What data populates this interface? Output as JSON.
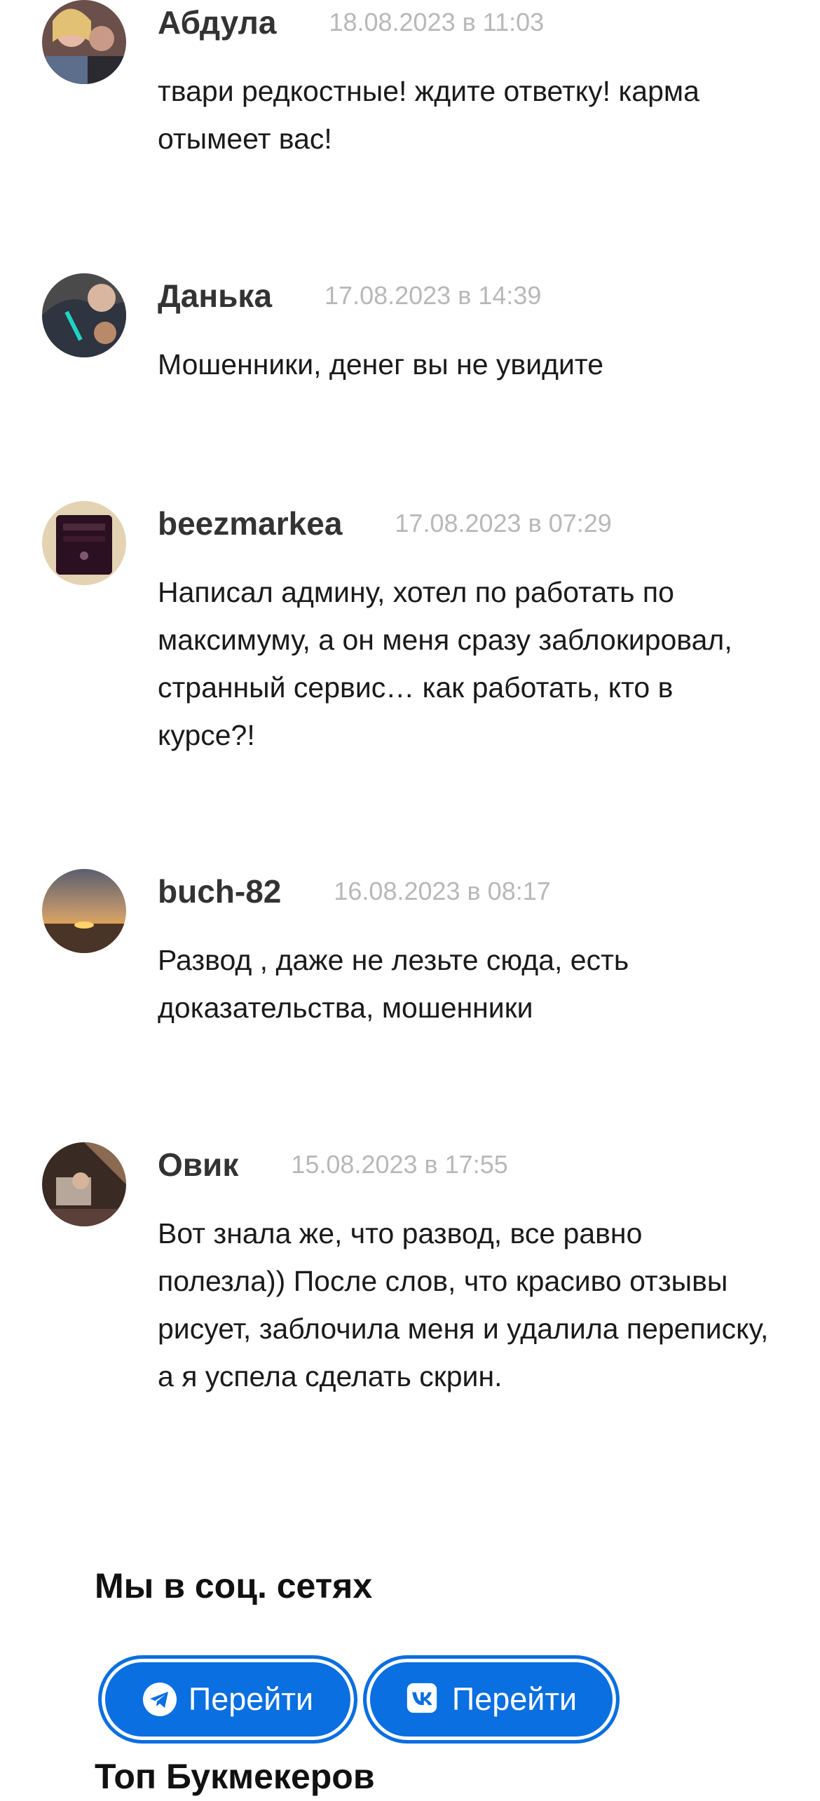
{
  "comments": [
    {
      "author": "Абдула",
      "date": "18.08.2023 в 11:03",
      "text": "твари редкостные! ждите ответку! карма отымеет вас!"
    },
    {
      "author": "Данька",
      "date": "17.08.2023 в 14:39",
      "text": "Мошенники, денег вы не увидите"
    },
    {
      "author": "beezmarkea",
      "date": "17.08.2023 в 07:29",
      "text": "Написал админу, хотел по работать по максимуму, а он меня сразу заблокировал, странный сервис… как работать, кто в курсе?!"
    },
    {
      "author": "buch-82",
      "date": "16.08.2023 в 08:17",
      "text": "Развод , даже не лезьте сюда, есть доказательства, мошенники"
    },
    {
      "author": "Овик",
      "date": "15.08.2023 в 17:55",
      "text": "Вот знала же, что развод, все равно полезла)) После слов, что красиво отзывы рисует, заблочила меня и удалила переписку, а я успела сделать скрин."
    }
  ],
  "social": {
    "title": "Мы в соц. сетях",
    "buttons": [
      {
        "icon": "telegram-icon",
        "label": "Перейти"
      },
      {
        "icon": "vk-icon",
        "label": "Перейти"
      }
    ]
  },
  "next_section": {
    "title": "Топ Букмекеров"
  },
  "colors": {
    "accent": "#0a6fe0",
    "author": "#333333",
    "date": "#b8b8b8",
    "text": "#1a1a1a"
  }
}
